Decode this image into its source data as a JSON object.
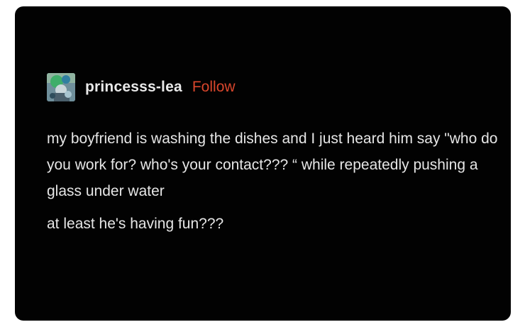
{
  "post": {
    "username": "princesss-lea",
    "follow_label": "Follow",
    "paragraphs": [
      "my boyfriend is washing the dishes and I just heard him say \"who do you work for? who's your contact??? “ while repeatedly pushing a glass under water",
      "at least he's having fun???"
    ]
  },
  "colors": {
    "card_background": "#020202",
    "follow": "#d9462c",
    "text": "#e6e6e6"
  },
  "icons": {
    "avatar": "avatar-icon"
  }
}
